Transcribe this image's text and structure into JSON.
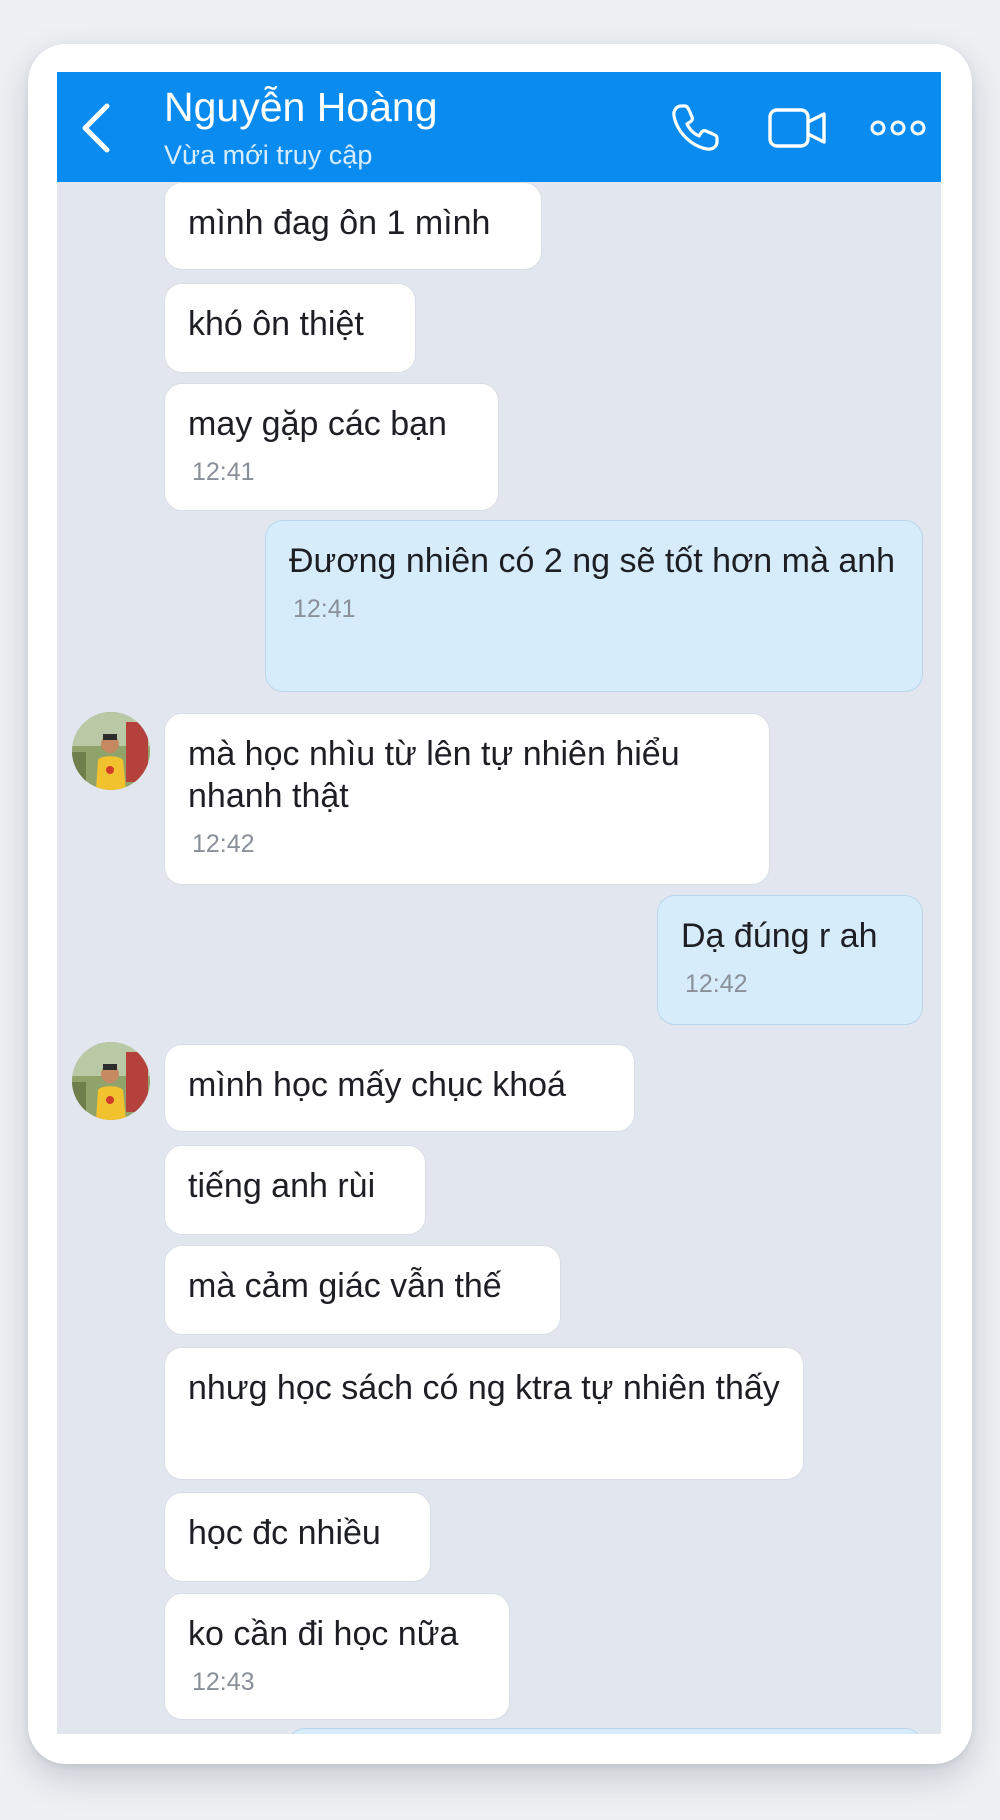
{
  "header": {
    "contact_name": "Nguyễn Hoàng",
    "status": "Vừa mới truy cập",
    "icons": [
      "chevron-left-icon",
      "phone-icon",
      "video-camera-icon",
      "more-options-icon"
    ]
  },
  "colors": {
    "header_blue": "#0a8bf0",
    "chat_background": "#e1e6ef",
    "incoming_bubble": "#ffffff",
    "outgoing_bubble": "#d6ecfb",
    "timestamp": "#8a9099"
  },
  "messages": [
    {
      "text": "mình đag ôn 1 mình",
      "time": ""
    },
    {
      "text": "khó ôn thiệt",
      "time": ""
    },
    {
      "text": "may gặp các bạn",
      "time": "12:41"
    },
    {
      "text": "Đương nhiên có 2 ng sẽ tốt hơn mà anh",
      "time": "12:41"
    },
    {
      "text": "mà học nhìu từ lên tự nhiên hiểu nhanh thật",
      "time": "12:42"
    },
    {
      "text": "Dạ đúng r ah",
      "time": "12:42"
    },
    {
      "text": "mình học mấy chục khoá",
      "time": ""
    },
    {
      "text": "tiếng anh rùi",
      "time": ""
    },
    {
      "text": "mà cảm giác vẫn thế",
      "time": ""
    },
    {
      "text": "nhưg học sách có ng ktra tự nhiên thấy",
      "time": ""
    },
    {
      "text": "học đc nhiều",
      "time": ""
    },
    {
      "text": "ko cần đi học nữa",
      "time": "12:43"
    }
  ]
}
